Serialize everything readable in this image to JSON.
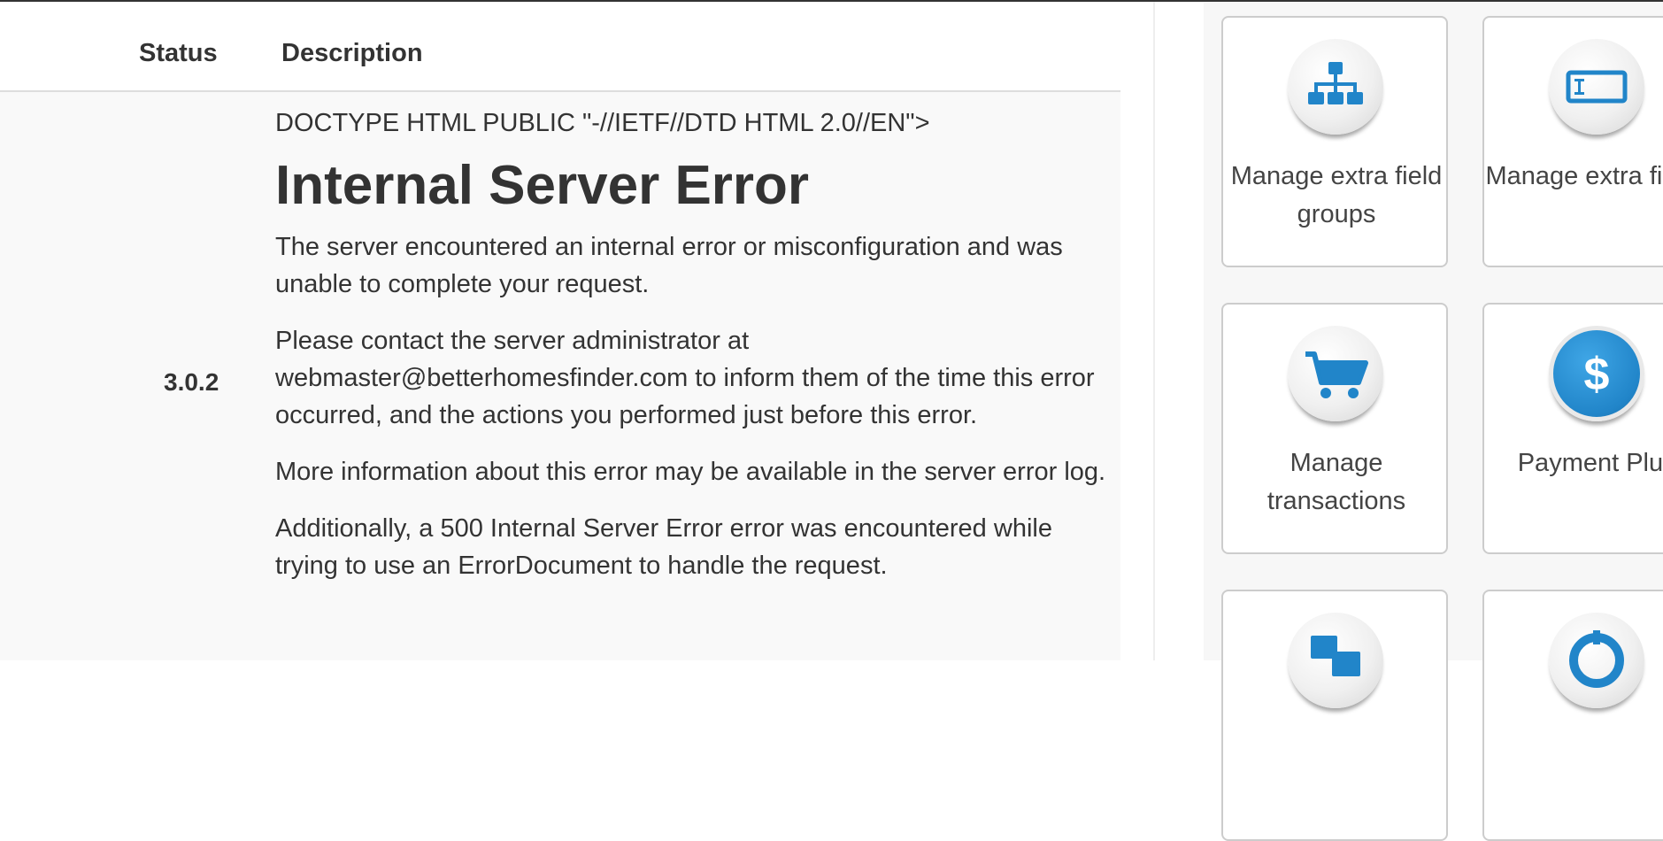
{
  "table": {
    "headers": {
      "status": "Status",
      "description": "Description"
    },
    "row": {
      "status": "3.0.2",
      "doctype": "DOCTYPE HTML PUBLIC \"-//IETF//DTD HTML 2.0//EN\">",
      "heading": "Internal Server Error",
      "paragraphs": [
        "The server encountered an internal error or misconfiguration and was unable to complete your request.",
        "Please contact the server administrator at webmaster@betterhomesfinder.com to inform them of the time this error occurred, and the actions you performed just before this error.",
        "More information about this error may be available in the server error log.",
        "Additionally, a 500 Internal Server Error error was encountered while trying to use an ErrorDocument to handle the request."
      ]
    }
  },
  "tiles": [
    {
      "label": "Manage extra field groups",
      "icon": "sitemap-icon"
    },
    {
      "label": "Manage extra fields",
      "icon": "textbox-icon"
    },
    {
      "label": "Manage transactions",
      "icon": "cart-icon"
    },
    {
      "label": "Payment Plug",
      "icon": "dollar-icon"
    },
    {
      "label": "",
      "icon": "translate-icon"
    },
    {
      "label": "",
      "icon": "lifebuoy-icon"
    }
  ],
  "colors": {
    "icon_blue": "#2185c9",
    "text": "#333333",
    "row_bg": "#f9f9f9"
  }
}
